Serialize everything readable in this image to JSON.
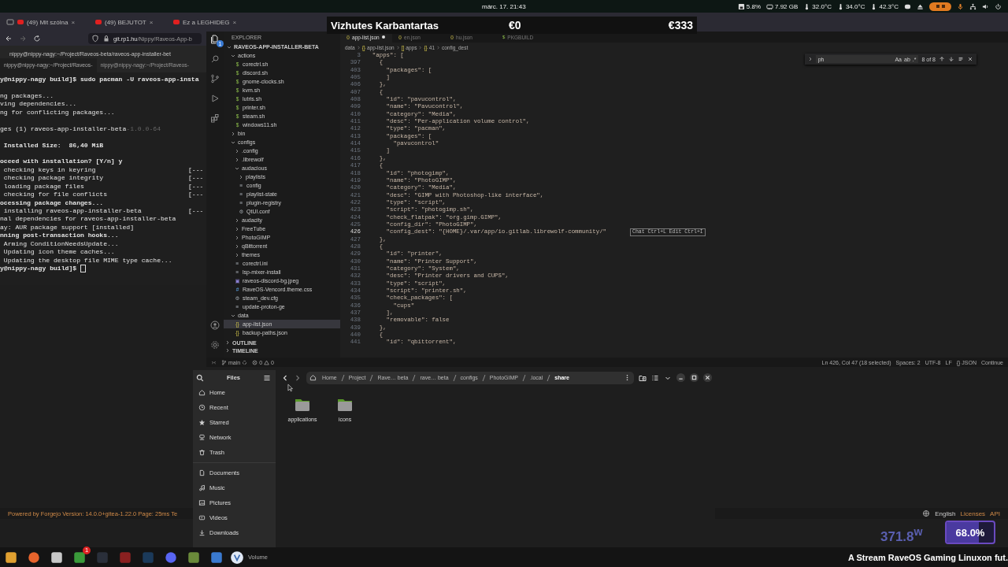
{
  "topbar": {
    "datetime": "márc. 17. 21:43",
    "stats": [
      {
        "kind": "disk",
        "label": "5.8%"
      },
      {
        "kind": "memory",
        "label": "7.92 GB"
      },
      {
        "kind": "temp",
        "label": "32.0°C"
      },
      {
        "kind": "temp",
        "label": "34.0°C"
      },
      {
        "kind": "temp",
        "label": "42.3°C"
      }
    ]
  },
  "overlay": {
    "title": "Vizhutes Karbantartas",
    "left_amount": "€0",
    "right_amount": "€333"
  },
  "browser": {
    "tabs": [
      {
        "label": "(49) Mit szólna",
        "close": "×"
      },
      {
        "label": "(49) BEJUTOT",
        "close": "×"
      },
      {
        "label": "Ez a LEGHIDEG",
        "close": "×"
      }
    ],
    "url_host": "git.rp1.hu",
    "url_path": "/Nippy/Raveos-App-b",
    "footer_text": "Powered by Forgejo Version: 14.0.0+gitea-1.22.0 Page: 25ms Te",
    "footer_links": [
      "English",
      "Licenses",
      "API"
    ]
  },
  "terminal": {
    "title": "nippy@nippy-nagy:~/Project/Raveos-beta/raveos-app-installer-bet",
    "tabs": [
      {
        "label": "nippy@nippy-nagy:~/Project/Raveos-",
        "selected": true
      },
      {
        "label": "nippy@nippy-nagy:~/Project/Raveos-",
        "selected": false
      }
    ],
    "lines": [
      {
        "kind": "line",
        "text": "y@nippy-nagy build]$ sudo pacman -U raveos-app-insta",
        "bold": true,
        "cursor": false
      },
      {
        "kind": "blank"
      },
      {
        "kind": "line",
        "text": "ng packages...",
        "bold": false,
        "cursor": false
      },
      {
        "kind": "line",
        "text": "ving dependencies...",
        "bold": false,
        "cursor": false
      },
      {
        "kind": "line",
        "text": "ng for conflicting packages...",
        "bold": false,
        "cursor": false
      },
      {
        "kind": "blank"
      },
      {
        "kind": "line",
        "text": "ges (1) raveos-app-installer-beta",
        "dim": "-1.0.0-64",
        "bold": false,
        "cursor": false
      },
      {
        "kind": "blank"
      },
      {
        "kind": "line",
        "text": " Installed Size:  86,40 MiB",
        "bold": true,
        "cursor": false
      },
      {
        "kind": "blank"
      },
      {
        "kind": "line",
        "text": "oceed with installation? [Y/n] y",
        "bold": true,
        "cursor": false
      },
      {
        "kind": "line",
        "text": " checking keys in keyring",
        "tail": "[---",
        "bold": false,
        "cursor": false
      },
      {
        "kind": "line",
        "text": " checking package integrity",
        "tail": "[---",
        "bold": false,
        "cursor": false
      },
      {
        "kind": "line",
        "text": " loading package files",
        "tail": "[---",
        "bold": false,
        "cursor": false
      },
      {
        "kind": "line",
        "text": " checking for file conflicts",
        "tail": "[---",
        "bold": false,
        "cursor": false
      },
      {
        "kind": "line",
        "text": "ocessing package changes...",
        "bold": true,
        "cursor": false
      },
      {
        "kind": "line",
        "text": " installing raveos-app-installer-beta",
        "tail": "[---",
        "bold": false,
        "cursor": false
      },
      {
        "kind": "line",
        "text": "nal dependencies for raveos-app-installer-beta",
        "bold": false,
        "cursor": false
      },
      {
        "kind": "line",
        "text": "ay: AUR package support [installed]",
        "bold": false,
        "cursor": false
      },
      {
        "kind": "line",
        "text": "nning post-transaction hooks...",
        "bold": true,
        "cursor": false
      },
      {
        "kind": "line",
        "text": " Arming ConditionNeedsUpdate...",
        "bold": false,
        "cursor": false
      },
      {
        "kind": "line",
        "text": " Updating icon theme caches...",
        "bold": false,
        "cursor": false
      },
      {
        "kind": "line",
        "text": " Updating the desktop file MIME type cache...",
        "bold": false,
        "cursor": false
      },
      {
        "kind": "line",
        "text": "y@nippy-nagy build]$",
        "bold": true,
        "cursor": true
      }
    ]
  },
  "editor": {
    "explorer_title": "EXPLORER",
    "explorer_badge": "1",
    "tree": [
      {
        "label": "RAVEOS-APP-INSTALLER-BETA",
        "kind": "root",
        "expanded": true,
        "selected": false,
        "children": [
          {
            "label": "actions",
            "kind": "folder",
            "expanded": true,
            "selected": false,
            "children": [
              {
                "label": "corectrl.sh",
                "kind": "sh",
                "icon": "$",
                "selected": false
              },
              {
                "label": "discord.sh",
                "kind": "sh",
                "icon": "$",
                "selected": false
              },
              {
                "label": "gnome-clocks.sh",
                "kind": "sh",
                "icon": "$",
                "selected": false
              },
              {
                "label": "kvm.sh",
                "kind": "sh",
                "icon": "$",
                "selected": false
              },
              {
                "label": "lutris.sh",
                "kind": "sh",
                "icon": "$",
                "selected": false
              },
              {
                "label": "printer.sh",
                "kind": "sh",
                "icon": "$",
                "selected": false
              },
              {
                "label": "steam.sh",
                "kind": "sh",
                "icon": "$",
                "selected": false
              },
              {
                "label": "windows11.sh",
                "kind": "sh",
                "icon": "$",
                "selected": false
              }
            ]
          },
          {
            "label": "bin",
            "kind": "folder",
            "expanded": false,
            "selected": false
          },
          {
            "label": "configs",
            "kind": "folder",
            "expanded": true,
            "selected": false,
            "children": [
              {
                "label": ".config",
                "kind": "folder",
                "expanded": false,
                "selected": false
              },
              {
                "label": ".librewolf",
                "kind": "folder",
                "expanded": false,
                "selected": false
              },
              {
                "label": "audacious",
                "kind": "folder",
                "expanded": true,
                "selected": false,
                "children": [
                  {
                    "label": "playlists",
                    "kind": "folder",
                    "expanded": false,
                    "selected": false
                  },
                  {
                    "label": "config",
                    "kind": "text",
                    "icon": "≡",
                    "selected": false
                  },
                  {
                    "label": "playlist-state",
                    "kind": "text",
                    "icon": "≡",
                    "selected": false
                  },
                  {
                    "label": "plugin-registry",
                    "kind": "text",
                    "icon": "≡",
                    "selected": false
                  },
                  {
                    "label": "QtUI.conf",
                    "kind": "conf",
                    "icon": "⚙",
                    "selected": false
                  }
                ]
              },
              {
                "label": "audacity",
                "kind": "folder",
                "expanded": false,
                "selected": false
              },
              {
                "label": "FreeTube",
                "kind": "folder",
                "expanded": false,
                "selected": false
              },
              {
                "label": "PhotoGIMP",
                "kind": "folder",
                "expanded": false,
                "selected": false
              },
              {
                "label": "qBittorrent",
                "kind": "folder",
                "expanded": false,
                "selected": false
              },
              {
                "label": "themes",
                "kind": "folder",
                "expanded": false,
                "selected": false
              },
              {
                "label": "corectrl.ini",
                "kind": "text",
                "icon": "≡",
                "selected": false
              },
              {
                "label": "lsp-mixer-install",
                "kind": "text",
                "icon": "≡",
                "selected": false
              },
              {
                "label": "raveos-discord-bg.jpeg",
                "kind": "image",
                "icon": "▣",
                "selected": false
              },
              {
                "label": "RaveOS-Vencord.theme.css",
                "kind": "css",
                "icon": "#",
                "selected": false
              },
              {
                "label": "steam_dev.cfg",
                "kind": "conf",
                "icon": "⚙",
                "selected": false
              },
              {
                "label": "update-proton-ge",
                "kind": "text",
                "icon": "≡",
                "selected": false
              }
            ]
          },
          {
            "label": "data",
            "kind": "folder",
            "expanded": true,
            "selected": false,
            "children": [
              {
                "label": "app-list.json",
                "kind": "json",
                "icon": "{}",
                "selected": true
              },
              {
                "label": "backup-paths.json",
                "kind": "json",
                "icon": "{}",
                "selected": false
              }
            ]
          }
        ]
      }
    ],
    "sections": [
      "OUTLINE",
      "TIMELINE"
    ],
    "tabs": [
      {
        "icon": "{}",
        "kind": "json",
        "label": "app-list.json",
        "selected": true,
        "modified": true
      },
      {
        "icon": "{}",
        "kind": "json",
        "label": "en.json",
        "selected": false,
        "modified": false
      },
      {
        "icon": "{}",
        "kind": "json",
        "label": "hu.json",
        "selected": false,
        "modified": false
      },
      {
        "icon": "$",
        "kind": "sh",
        "label": "PKGBUILD",
        "selected": false,
        "modified": false
      }
    ],
    "breadcrumb": [
      {
        "label": "data"
      },
      {
        "icon": "{}",
        "label": "app-list.json"
      },
      {
        "icon": "[]",
        "label": "apps"
      },
      {
        "icon": "{}",
        "label": "41"
      },
      {
        "label": "config_dest"
      }
    ],
    "find": {
      "value": "ph",
      "count": "8 of 8",
      "options": [
        "Aa",
        "ab",
        ".*"
      ]
    },
    "lines": [
      {
        "n": "3",
        "text": "  \"apps\": [",
        "current": false
      },
      {
        "n": "397",
        "text": "    {",
        "current": false
      },
      {
        "n": "403",
        "text": "      \"packages\": [",
        "current": false
      },
      {
        "n": "405",
        "text": "      ]",
        "current": false
      },
      {
        "n": "406",
        "text": "    },",
        "current": false
      },
      {
        "n": "407",
        "text": "    {",
        "current": false
      },
      {
        "n": "408",
        "text": "      \"id\": \"pavucontrol\",",
        "current": false
      },
      {
        "n": "409",
        "text": "      \"name\": \"Pavucontrol\",",
        "current": false
      },
      {
        "n": "410",
        "text": "      \"category\": \"Media\",",
        "current": false
      },
      {
        "n": "411",
        "text": "      \"desc\": \"Per-application volume control\",",
        "current": false
      },
      {
        "n": "412",
        "text": "      \"type\": \"pacman\",",
        "current": false
      },
      {
        "n": "413",
        "text": "      \"packages\": [",
        "current": false
      },
      {
        "n": "414",
        "text": "        \"pavucontrol\"",
        "current": false
      },
      {
        "n": "415",
        "text": "      ]",
        "current": false
      },
      {
        "n": "416",
        "text": "    },",
        "current": false
      },
      {
        "n": "417",
        "text": "    {",
        "current": false
      },
      {
        "n": "418",
        "text": "      \"id\": \"photogimp\",",
        "current": false
      },
      {
        "n": "419",
        "text": "      \"name\": \"PhotoGIMP\",",
        "current": false
      },
      {
        "n": "420",
        "text": "      \"category\": \"Media\",",
        "current": false
      },
      {
        "n": "421",
        "text": "      \"desc\": \"GIMP with Photoshop-like interface\",",
        "current": false
      },
      {
        "n": "422",
        "text": "      \"type\": \"script\",",
        "current": false
      },
      {
        "n": "423",
        "text": "      \"script\": \"photogimp.sh\",",
        "current": false
      },
      {
        "n": "424",
        "text": "      \"check_flatpak\": \"org.gimp.GIMP\",",
        "current": false
      },
      {
        "n": "425",
        "text": "      \"config_dir\": \"PhotoGIMP\",",
        "current": false
      },
      {
        "n": "426",
        "text": "      \"config_dest\": \"{HOME}/.var/app/io.gitlab.librewolf-community/\"",
        "current": true,
        "hint": "Chat Ctrl+L Edit Ctrl+I"
      },
      {
        "n": "427",
        "text": "    },",
        "current": false
      },
      {
        "n": "428",
        "text": "    {",
        "current": false
      },
      {
        "n": "429",
        "text": "      \"id\": \"printer\",",
        "current": false
      },
      {
        "n": "430",
        "text": "      \"name\": \"Printer Support\",",
        "current": false
      },
      {
        "n": "431",
        "text": "      \"category\": \"System\",",
        "current": false
      },
      {
        "n": "432",
        "text": "      \"desc\": \"Printer drivers and CUPS\",",
        "current": false
      },
      {
        "n": "433",
        "text": "      \"type\": \"script\",",
        "current": false
      },
      {
        "n": "434",
        "text": "      \"script\": \"printer.sh\",",
        "current": false
      },
      {
        "n": "435",
        "text": "      \"check_packages\": [",
        "current": false
      },
      {
        "n": "436",
        "text": "        \"cups\"",
        "current": false
      },
      {
        "n": "437",
        "text": "      ],",
        "current": false
      },
      {
        "n": "438",
        "text": "      \"removable\": false",
        "current": false
      },
      {
        "n": "439",
        "text": "    },",
        "current": false
      },
      {
        "n": "440",
        "text": "    {",
        "current": false
      },
      {
        "n": "441",
        "text": "      \"id\": \"qbittorrent\",",
        "current": false
      }
    ],
    "status_left": {
      "branch": "main",
      "errors": "0",
      "warnings": "0"
    },
    "status_right": [
      "Ln 426, Col 47 (18 selected)",
      "Spaces: 2",
      "UTF-8",
      "LF",
      "{} JSON",
      "Continue"
    ]
  },
  "files": {
    "title": "Files",
    "places": [
      {
        "kind": "home",
        "label": "Home"
      },
      {
        "kind": "recent",
        "label": "Recent"
      },
      {
        "kind": "starred",
        "label": "Starred"
      },
      {
        "kind": "network",
        "label": "Network"
      },
      {
        "kind": "trash",
        "label": "Trash"
      }
    ],
    "bookmarks": [
      {
        "kind": "document",
        "label": "Documents"
      },
      {
        "kind": "music",
        "label": "Music"
      },
      {
        "kind": "pictures",
        "label": "Pictures"
      },
      {
        "kind": "videos",
        "label": "Videos"
      },
      {
        "kind": "downloads",
        "label": "Downloads"
      }
    ],
    "path": [
      {
        "label": "Home",
        "selected": false
      },
      {
        "label": "Project",
        "selected": false
      },
      {
        "label": "Rave… beta",
        "selected": false
      },
      {
        "label": "rave… beta",
        "selected": false
      },
      {
        "label": "configs",
        "selected": false
      },
      {
        "label": "PhotoGIMP",
        "selected": false
      },
      {
        "label": ".local",
        "selected": false
      },
      {
        "label": "share",
        "selected": true
      }
    ],
    "folders": [
      "applications",
      "icons"
    ]
  },
  "stream": {
    "power": "371.8$^{w}$",
    "load": "68.0%",
    "level": 0.68,
    "ticker": "A Stream RaveOS Gaming Linuxon fut."
  },
  "taskbar": {
    "badge": "1",
    "volume_label": "Volume"
  }
}
